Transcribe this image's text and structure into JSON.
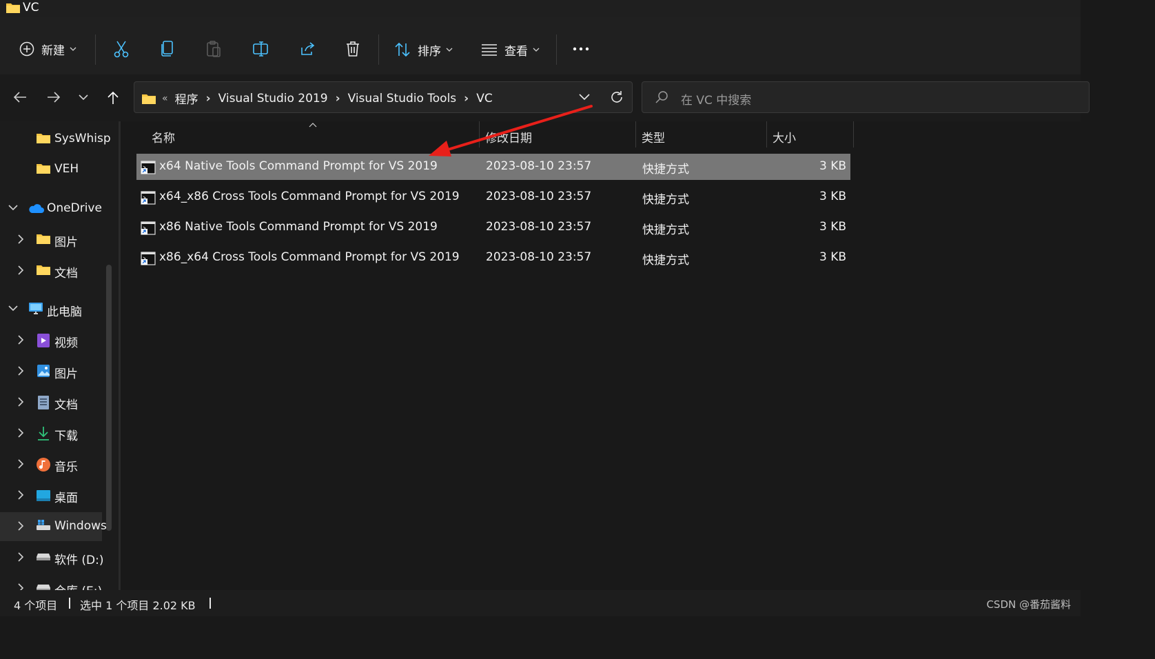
{
  "window": {
    "title": "VC"
  },
  "toolbar": {
    "new_label": "新建",
    "sort_label": "排序",
    "view_label": "查看"
  },
  "address": {
    "overflow": "«",
    "crumbs": [
      "程序",
      "Visual Studio 2019",
      "Visual Studio Tools",
      "VC"
    ]
  },
  "search": {
    "placeholder": "在 VC 中搜索"
  },
  "sidebar": {
    "items": [
      {
        "label": "SysWhisp",
        "icon": "folder-icon"
      },
      {
        "label": "VEH",
        "icon": "folder-icon"
      },
      {
        "label": "OneDrive",
        "icon": "cloud-icon"
      },
      {
        "label": "图片",
        "icon": "folder-icon"
      },
      {
        "label": "文档",
        "icon": "folder-icon"
      },
      {
        "label": "此电脑",
        "icon": "computer-icon"
      },
      {
        "label": "视频",
        "icon": "video-icon"
      },
      {
        "label": "图片",
        "icon": "pictures-icon"
      },
      {
        "label": "文档",
        "icon": "documents-icon"
      },
      {
        "label": "下载",
        "icon": "download-icon"
      },
      {
        "label": "音乐",
        "icon": "music-icon"
      },
      {
        "label": "桌面",
        "icon": "desktop-icon"
      },
      {
        "label": "Windows",
        "icon": "drive-windows-icon"
      },
      {
        "label": "软件 (D:)",
        "icon": "drive-icon"
      },
      {
        "label": "仓库 (E:)",
        "icon": "drive-icon"
      }
    ]
  },
  "table": {
    "columns": [
      "名称",
      "修改日期",
      "类型",
      "大小"
    ],
    "rows": [
      {
        "name": "x64 Native Tools Command Prompt for VS 2019",
        "date": "2023-08-10 23:57",
        "type": "快捷方式",
        "size": "3 KB"
      },
      {
        "name": "x64_x86 Cross Tools Command Prompt for VS 2019",
        "date": "2023-08-10 23:57",
        "type": "快捷方式",
        "size": "3 KB"
      },
      {
        "name": "x86 Native Tools Command Prompt for VS 2019",
        "date": "2023-08-10 23:57",
        "type": "快捷方式",
        "size": "3 KB"
      },
      {
        "name": "x86_x64 Cross Tools Command Prompt for VS 2019",
        "date": "2023-08-10 23:57",
        "type": "快捷方式",
        "size": "3 KB"
      }
    ]
  },
  "status": {
    "count": "4 个项目",
    "selected": "选中 1 个项目  2.02 KB"
  },
  "watermark": "CSDN @番茄酱料",
  "colors": {
    "folder": "#f5c542",
    "accent": "#4cc2ff",
    "annotation_arrow": "#e8201a"
  }
}
